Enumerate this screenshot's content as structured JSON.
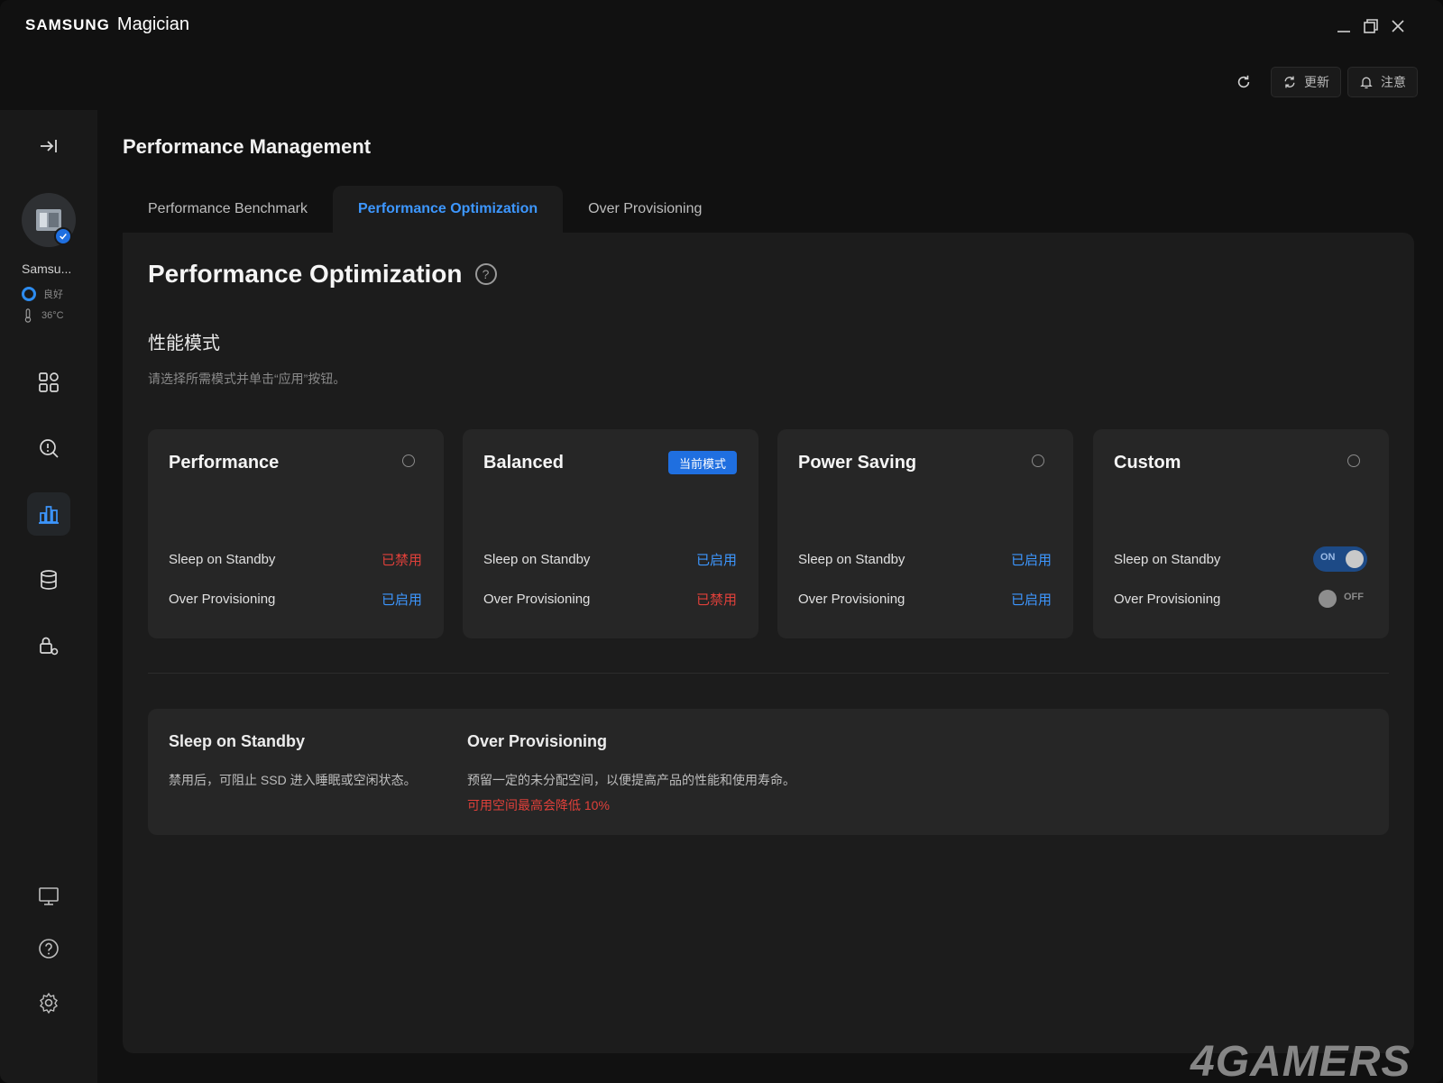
{
  "app": {
    "brand": "SAMSUNG",
    "name": "Magician"
  },
  "toolbar": {
    "update_label": "更新",
    "notice_label": "注意"
  },
  "device": {
    "name": "Samsu...",
    "status": "良好",
    "temperature": "36°C"
  },
  "page": {
    "title": "Performance Management"
  },
  "tabs": [
    {
      "label": "Performance Benchmark"
    },
    {
      "label": "Performance Optimization"
    },
    {
      "label": "Over Provisioning"
    }
  ],
  "optimization": {
    "title": "Performance Optimization",
    "help": "?",
    "mode_heading": "性能模式",
    "mode_subtitle": "请选择所需模式并单击“应用”按钮。"
  },
  "cards": [
    {
      "name": "Performance",
      "selected": false,
      "rows": [
        {
          "label": "Sleep on Standby",
          "value": "已禁用"
        },
        {
          "label": "Over Provisioning",
          "value": "已启用"
        }
      ]
    },
    {
      "name": "Balanced",
      "selected": true,
      "badge": "当前模式",
      "rows": [
        {
          "label": "Sleep on Standby",
          "value": "已启用"
        },
        {
          "label": "Over Provisioning",
          "value": "已禁用"
        }
      ]
    },
    {
      "name": "Power Saving",
      "selected": false,
      "rows": [
        {
          "label": "Sleep on Standby",
          "value": "已启用"
        },
        {
          "label": "Over Provisioning",
          "value": "已启用"
        }
      ]
    },
    {
      "name": "Custom",
      "selected": false,
      "rows": [
        {
          "label": "Sleep on Standby",
          "toggle": "ON"
        },
        {
          "label": "Over Provisioning",
          "toggle": "OFF"
        }
      ]
    }
  ],
  "info": {
    "sleep": {
      "title": "Sleep on Standby",
      "desc": "禁用后，可阻止 SSD 进入睡眠或空闲状态。"
    },
    "op": {
      "title": "Over Provisioning",
      "desc": "预留一定的未分配空间，以便提高产品的性能和使用寿命。",
      "warning": "可用空间最高会降低 10%"
    }
  },
  "watermark": "4GAMERS",
  "colors": {
    "accent": "#3d97ff",
    "enabled": "#3d97ff",
    "disabled": "#e0403a",
    "badge": "#1f6fe0"
  }
}
